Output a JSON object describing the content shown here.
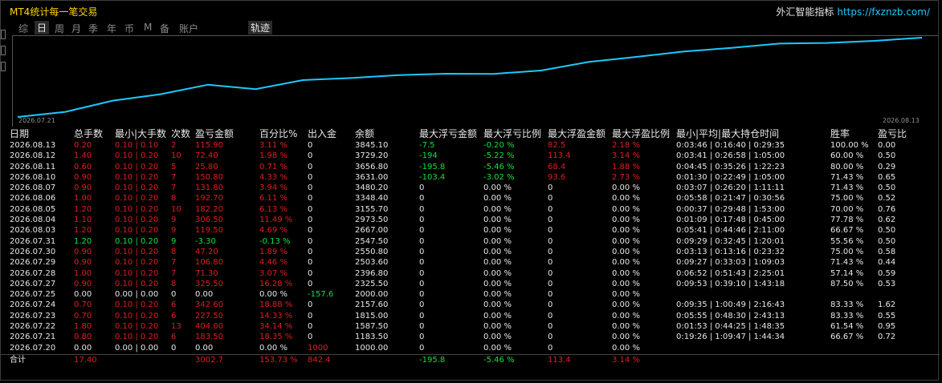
{
  "window": {
    "title": "MT4统计每一笔交易",
    "brand": "外汇智能指标",
    "url": "https://fxznzb.com/"
  },
  "tabs": [
    "综",
    "日",
    "周",
    "月",
    "季",
    "年",
    "币",
    "M",
    "备",
    "账户"
  ],
  "active_tab": "日",
  "track_button": "轨迹",
  "colors": {
    "accent": "#1ec8ff",
    "profit": "#16e03c",
    "loss": "#e01e1e",
    "title": "#ffd400"
  },
  "chart_data": {
    "type": "line",
    "x": [
      "2026.07.20",
      "2026.07.21",
      "2026.07.22",
      "2026.07.23",
      "2026.07.24",
      "2026.07.25",
      "2026.07.27",
      "2026.07.28",
      "2026.07.29",
      "2026.07.30",
      "2026.07.31",
      "2026.08.03",
      "2026.08.04",
      "2026.08.05",
      "2026.08.06",
      "2026.08.07",
      "2026.08.10",
      "2026.08.11",
      "2026.08.12",
      "2026.08.13"
    ],
    "values": [
      1000,
      1183.5,
      1587.5,
      1815,
      2157.6,
      2000,
      2325.5,
      2396.8,
      2503.6,
      2550.8,
      2547.5,
      2667,
      2973.5,
      3155.7,
      3348.4,
      3480.2,
      3631,
      3656.8,
      3729.2,
      3845.1
    ],
    "x_start_label": "2026.07.21",
    "x_end_label": "2026.08.13",
    "color": "#1ec8ff"
  },
  "table": {
    "headers": [
      "日期",
      "总手数",
      "最小|大手数",
      "次数",
      "盈亏金额",
      "百分比%",
      "出入金",
      "余额",
      "最大浮亏金额",
      "最大浮亏比例",
      "最大浮盈金额",
      "最大浮盈比例",
      "最小|平均|最大持仓时间",
      "胜率",
      "盈亏比"
    ],
    "rows": [
      [
        "2026.08.13",
        "0.20",
        "0.10 | 0.10",
        "2",
        "115.90",
        "3.11 %",
        "0",
        "3845.10",
        "-7.5",
        "-0.20 %",
        "82.5",
        "2.18 %",
        "0:03:46 | 0:16:40 | 0:29:35",
        "100.00 %",
        "0.00"
      ],
      [
        "2026.08.12",
        "1.40",
        "0.10 | 0.20",
        "10",
        "72.40",
        "1.98 %",
        "0",
        "3729.20",
        "-194",
        "-5.22 %",
        "113.4",
        "3.14 %",
        "0:03:41 | 0:26:58 | 1:05:00",
        "60.00 %",
        "0.50"
      ],
      [
        "2026.08.11",
        "0.60",
        "0.10 | 0.20",
        "5",
        "25.80",
        "0.71 %",
        "0",
        "3656.80",
        "-195.8",
        "-5.46 %",
        "68.4",
        "1.88 %",
        "0:04:45 | 0:35:26 | 1:22:23",
        "80.00 %",
        "0.29"
      ],
      [
        "2026.08.10",
        "0.90",
        "0.10 | 0.20",
        "7",
        "150.80",
        "4.33 %",
        "0",
        "3631.00",
        "-103.4",
        "-3.02 %",
        "93.6",
        "2.73 %",
        "0:01:30 | 0:22:49 | 1:05:00",
        "71.43 %",
        "0.65"
      ],
      [
        "2026.08.07",
        "0.90",
        "0.10 | 0.20",
        "7",
        "131.80",
        "3.94 %",
        "0",
        "3480.20",
        "0",
        "0.00 %",
        "0",
        "0.00 %",
        "0:03:07 | 0:26:20 | 1:11:11",
        "71.43 %",
        "0.50"
      ],
      [
        "2026.08.06",
        "1.00",
        "0.10 | 0.20",
        "8",
        "192.70",
        "6.11 %",
        "0",
        "3348.40",
        "0",
        "0.00 %",
        "0",
        "0.00 %",
        "0:05:58 | 0:21:47 | 0:30:56",
        "75.00 %",
        "0.52"
      ],
      [
        "2026.08.05",
        "1.20",
        "0.10 | 0.20",
        "10",
        "182.20",
        "6.13 %",
        "0",
        "3155.70",
        "0",
        "0.00 %",
        "0",
        "0.00 %",
        "0:00:37 | 0:29:48 | 1:53:00",
        "70.00 %",
        "0.76"
      ],
      [
        "2026.08.04",
        "1.10",
        "0.10 | 0.20",
        "9",
        "306.50",
        "11.49 %",
        "0",
        "2973.50",
        "0",
        "0.00 %",
        "0",
        "0.00 %",
        "0:01:09 | 0:17:48 | 0:45:00",
        "77.78 %",
        "0.62"
      ],
      [
        "2026.08.03",
        "1.20",
        "0.10 | 0.20",
        "9",
        "119.50",
        "4.69 %",
        "0",
        "2667.00",
        "0",
        "0.00 %",
        "0",
        "0.00 %",
        "0:05:41 | 0:44:46 | 2:11:00",
        "66.67 %",
        "0.50"
      ],
      [
        "2026.07.31",
        "1.20",
        "0.10 | 0.20",
        "9",
        "-3.30",
        "-0.13 %",
        "0",
        "2547.50",
        "0",
        "0.00 %",
        "0",
        "0.00 %",
        "0:09:29 | 0:32:45 | 1:20:01",
        "55.56 %",
        "0.50"
      ],
      [
        "2026.07.30",
        "0.90",
        "0.10 | 0.20",
        "8",
        "47.20",
        "1.89 %",
        "0",
        "2550.80",
        "0",
        "0.00 %",
        "0",
        "0.00 %",
        "0:03:13 | 0:13:16 | 0:23:32",
        "75.00 %",
        "0.58"
      ],
      [
        "2026.07.29",
        "0.90",
        "0.10 | 0.20",
        "7",
        "106.80",
        "4.46 %",
        "0",
        "2503.60",
        "0",
        "0.00 %",
        "0",
        "0.00 %",
        "0:09:27 | 0:33:03 | 1:09:03",
        "71.43 %",
        "0.44"
      ],
      [
        "2026.07.28",
        "1.00",
        "0.10 | 0.20",
        "7",
        "71.30",
        "3.07 %",
        "0",
        "2396.80",
        "0",
        "0.00 %",
        "0",
        "0.00 %",
        "0:06:52 | 0:51:43 | 2:25:01",
        "57.14 %",
        "0.59"
      ],
      [
        "2026.07.27",
        "0.90",
        "0.10 | 0.20",
        "8",
        "325.50",
        "16.28 %",
        "0",
        "2325.50",
        "0",
        "0.00 %",
        "0",
        "0.00 %",
        "0:09:53 | 0:39:10 | 1:43:18",
        "87.50 %",
        "0.53"
      ],
      [
        "2026.07.25",
        "0.00",
        "0.00 | 0.00",
        "0",
        "0.00",
        "0.00 %",
        "-157.6",
        "2000.00",
        "0",
        "0.00 %",
        "0",
        "0.00 %",
        "",
        "",
        ""
      ],
      [
        "2026.07.24",
        "0.70",
        "0.10 | 0.20",
        "6",
        "342.60",
        "18.88 %",
        "0",
        "2157.60",
        "0",
        "0.00 %",
        "0",
        "0.00 %",
        "0:09:35 | 1:00:49 | 2:16:43",
        "83.33 %",
        "1.62"
      ],
      [
        "2026.07.23",
        "0.70",
        "0.10 | 0.20",
        "6",
        "227.50",
        "14.33 %",
        "0",
        "1815.00",
        "0",
        "0.00 %",
        "0",
        "0.00 %",
        "0:05:55 | 0:48:30 | 2:43:13",
        "83.33 %",
        "0.55"
      ],
      [
        "2026.07.22",
        "1.80",
        "0.10 | 0.20",
        "13",
        "404.00",
        "34.14 %",
        "0",
        "1587.50",
        "0",
        "0.00 %",
        "0",
        "0.00 %",
        "0:01:53 | 0:44:25 | 1:48:35",
        "61.54 %",
        "0.95"
      ],
      [
        "2026.07.21",
        "0.80",
        "0.10 | 0.20",
        "6",
        "183.50",
        "18.35 %",
        "0",
        "1183.50",
        "0",
        "0.00 %",
        "0",
        "0.00 %",
        "0:19:26 | 1:09:47 | 1:44:34",
        "66.67 %",
        "0.72"
      ],
      [
        "2026.07.20",
        "0.00",
        "0.00 | 0.00",
        "0",
        "0.00",
        "0.00 %",
        "1000",
        "1000.00",
        "0",
        "0.00 %",
        "0",
        "0.00 %",
        "",
        "",
        ""
      ]
    ],
    "total": [
      "合计",
      "17.40",
      "",
      "",
      "3002.7",
      "153.73 %",
      "842.4",
      "",
      "-195.8",
      "-5.46 %",
      "113.4",
      "3.14 %",
      "",
      "",
      ""
    ]
  }
}
